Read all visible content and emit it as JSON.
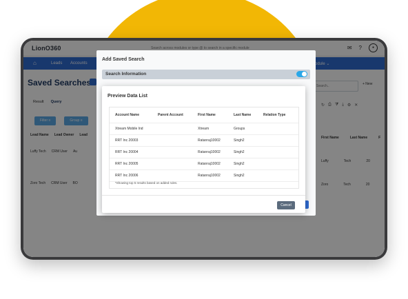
{
  "app": {
    "logo": "LionO360",
    "search_hint": "Search across modules or type @ to search in a specific module"
  },
  "nav": {
    "items": [
      "Leads",
      "Accounts"
    ],
    "right_item": "Module ⌄"
  },
  "page": {
    "title": "Saved Searches -",
    "tabs": [
      "Result",
      "Query"
    ],
    "filters": [
      "Filter ≡",
      "Group ≡"
    ],
    "bg_columns": [
      "Lead Name",
      "Lead Owner",
      "Lead"
    ],
    "bg_rows": [
      [
        "Luffy Tech",
        "CRM User",
        "Au"
      ],
      [
        "Zoro Tech",
        "CRM User",
        "BO"
      ]
    ],
    "search_placeholder": "Search..",
    "new_label": "+ New",
    "right_columns": [
      "First Name",
      "Last Name",
      "F"
    ],
    "right_rows": [
      [
        "Luffy",
        "Tech",
        "20"
      ],
      [
        "Zoro",
        "Tech",
        "20"
      ]
    ]
  },
  "modal_saved_search": {
    "title": "Add Saved Search",
    "section": "Search Information"
  },
  "preview": {
    "title": "Preview Data List",
    "columns": [
      "Account Name",
      "Parent Account",
      "First Name",
      "Last Name",
      "Relation Type"
    ],
    "rows": [
      [
        "Xtream Mobile Ind",
        "",
        "Xtream",
        "Groups",
        ""
      ],
      [
        "RRT Inc 20003",
        "",
        "Ratanraj10002",
        "Singh2",
        ""
      ],
      [
        "RRT Inc 20004",
        "",
        "Ratanraj10002",
        "Singh2",
        ""
      ],
      [
        "RRT Inc 20005",
        "",
        "Ratanraj10002",
        "Singh2",
        ""
      ],
      [
        "RRT Inc 20006",
        "",
        "Ratanraj10002",
        "Singh2",
        ""
      ]
    ],
    "note": "*Showing top 5 results based on added rules.",
    "cancel_label": "Cancel"
  },
  "colors": {
    "accent": "#2f6bd1",
    "highlight": "#f2b705",
    "toggle": "#2aa7e8"
  }
}
